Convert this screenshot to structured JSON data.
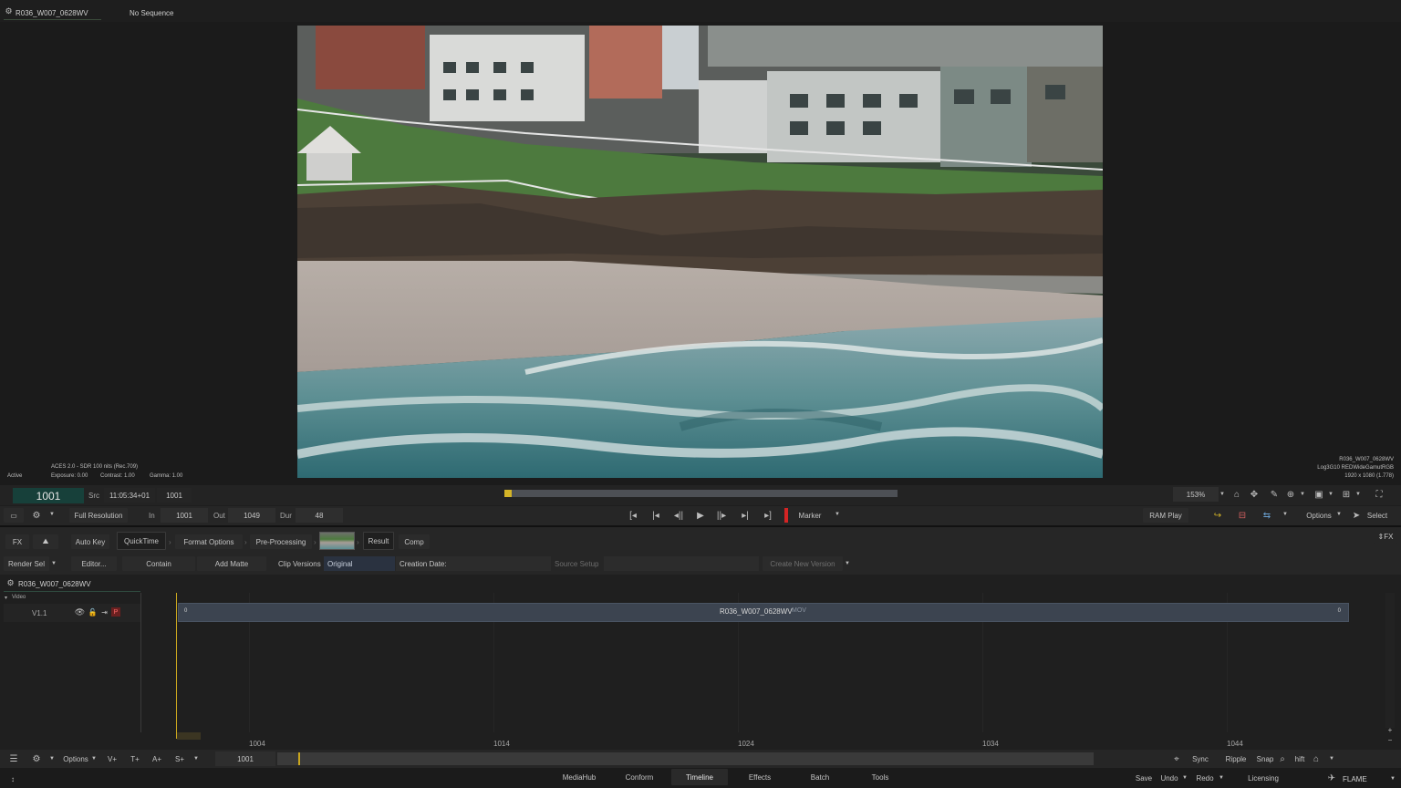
{
  "top_bar": {
    "clip_name": "R036_W007_0628WV",
    "sequence": "No Sequence"
  },
  "viewer": {
    "left_info": {
      "status": "Active",
      "colorspace": "ACES 2.0 - SDR 100 nits (Rec.709)",
      "exposure": "Exposure: 0.00",
      "contrast": "Contrast: 1.00",
      "gamma": "Gamma: 1.00"
    },
    "right_info": {
      "clip": "R036_W007_0628WV",
      "encoding": "Log3G10 REDWideGamutRGB",
      "resolution": "1920 x 1080 (1.778)"
    }
  },
  "transport": {
    "frame": "1001",
    "src_label": "Src",
    "src_tc": "11:05:34+01",
    "src_frame": "1001",
    "resolution": "Full Resolution",
    "in_label": "In",
    "in_value": "1001",
    "out_label": "Out",
    "out_value": "1049",
    "dur_label": "Dur",
    "dur_value": "48",
    "marker": "Marker",
    "ram_play": "RAM Play",
    "zoom": "153%",
    "options": "Options",
    "select": "Select"
  },
  "tabs_row": {
    "fx": "FX",
    "auto_key": "Auto Key",
    "quicktime": "QuickTime",
    "format_options": "Format Options",
    "pre_processing": "Pre-Processing",
    "result": "Result",
    "comp": "Comp",
    "fx_right": "FX"
  },
  "controls_row": {
    "render_sel": "Render Sel",
    "editor": "Editor...",
    "contain": "Contain",
    "add_matte": "Add Matte",
    "clip_versions": "Clip Versions",
    "original": "Original",
    "creation_date": "Creation Date:",
    "source_setup": "Source Setup",
    "create_new_version": "Create New Version"
  },
  "timeline": {
    "sequence_name": "R036_W007_0628WV",
    "video_label": "Video",
    "track": "V1.1",
    "track_badge": "P",
    "clip_label": "R036_W007_0628WV",
    "clip_format": "MOV",
    "clip_in": "0",
    "clip_out": "0",
    "ruler": [
      "1004",
      "1014",
      "1024",
      "1034",
      "1044"
    ]
  },
  "bottom_toolbar": {
    "options": "Options",
    "v_plus": "V+",
    "t_plus": "T+",
    "a_plus": "A+",
    "s_plus": "S+",
    "frame": "1001",
    "sync": "Sync",
    "ripple": "Ripple",
    "snap": "Snap",
    "shift": "hift"
  },
  "nav_tabs": [
    "MediaHub",
    "Conform",
    "Timeline",
    "Effects",
    "Batch",
    "Tools"
  ],
  "active_tab": "Timeline",
  "footer": {
    "save": "Save",
    "undo": "Undo",
    "redo": "Redo",
    "licensing": "Licensing",
    "brand": "FLAME"
  },
  "colors": {
    "accent": "#d4b427",
    "playhead_red": "#d42424",
    "frame_green": "#17403a"
  }
}
